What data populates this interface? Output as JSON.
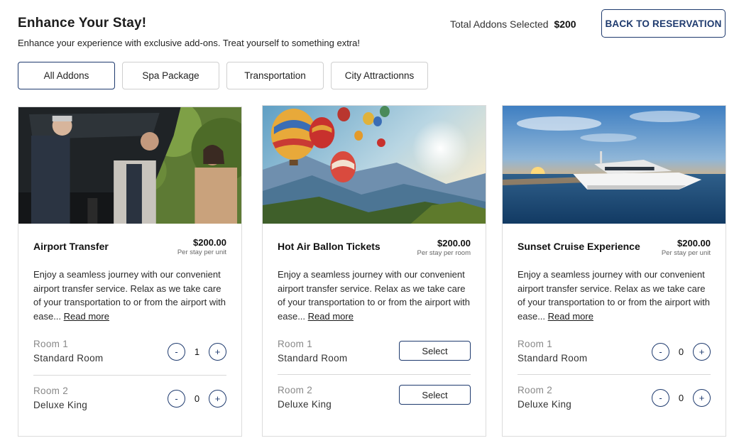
{
  "header": {
    "title": "Enhance Your Stay!",
    "subtitle": "Enhance your experience with exclusive add-ons. Treat yourself to something extra!",
    "total_label": "Total Addons Selected",
    "total_value": "$200",
    "back_button": "BACK TO RESERVATION"
  },
  "filters": [
    {
      "label": "All Addons",
      "active": true
    },
    {
      "label": "Spa Package",
      "active": false
    },
    {
      "label": "Transportation",
      "active": false
    },
    {
      "label": "City Attractionns",
      "active": false
    }
  ],
  "cards": [
    {
      "name": "Airport Transfer",
      "price": "$200.00",
      "unit": "Per stay per unit",
      "description": "Enjoy a seamless journey with our convenient airport transfer service. Relax as we take care of your transportation to or from the airport with ease...",
      "read_more": "Read more",
      "rooms": [
        {
          "label": "Room 1",
          "type": "Standard Room",
          "qty": "1"
        },
        {
          "label": "Room 2",
          "type": "Deluxe King",
          "qty": "0"
        }
      ]
    },
    {
      "name": "Hot Air Ballon Tickets",
      "price": "$200.00",
      "unit": "Per stay per room",
      "description": "Enjoy a seamless journey with our convenient airport transfer service. Relax as we take care of your transportation to or from the airport with ease...",
      "read_more": "Read more",
      "rooms": [
        {
          "label": "Room 1",
          "type": "Standard Room",
          "action": "Select"
        },
        {
          "label": "Room 2",
          "type": "Deluxe King",
          "action": "Select"
        }
      ]
    },
    {
      "name": "Sunset Cruise Experience",
      "price": "$200.00",
      "unit": "Per stay per unit",
      "description": "Enjoy a seamless journey with our convenient airport transfer service. Relax as we take care of your transportation to or from the airport with ease...",
      "read_more": "Read more",
      "rooms": [
        {
          "label": "Room 1",
          "type": "Standard Room",
          "qty": "0"
        },
        {
          "label": "Room 2",
          "type": "Deluxe King",
          "qty": "0"
        }
      ]
    }
  ],
  "stepper": {
    "minus": "-",
    "plus": "+"
  },
  "colors": {
    "accent": "#1e3a6e",
    "border": "#dcdcdc",
    "muted_text": "#888888"
  }
}
